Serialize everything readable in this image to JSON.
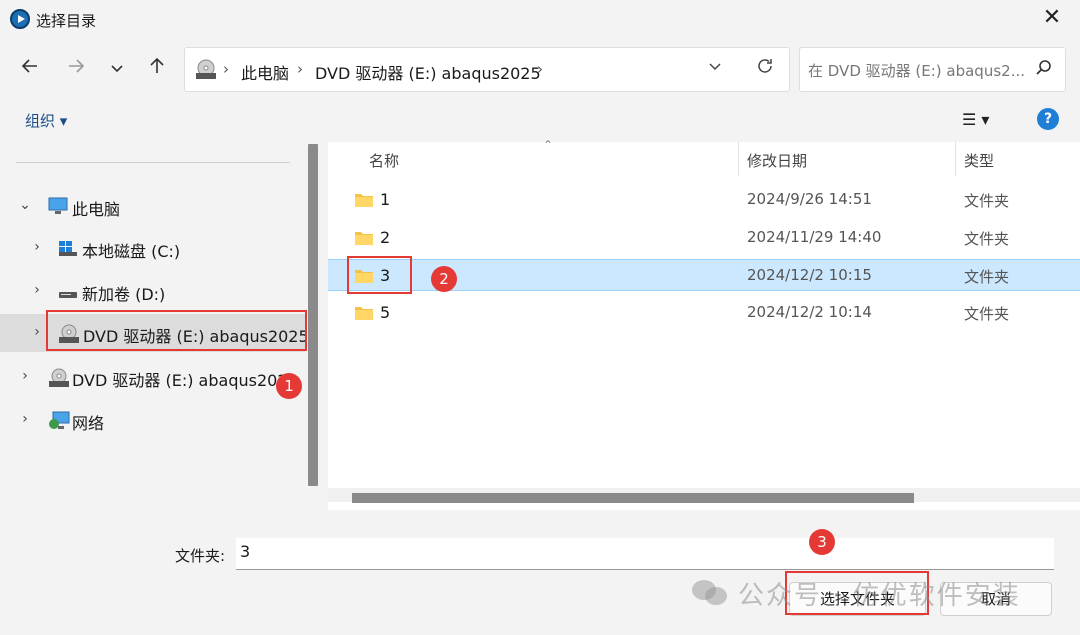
{
  "window": {
    "title": "选择目录",
    "close_glyph": "✕"
  },
  "nav": {
    "back_icon": "arrow-left-icon",
    "forward_icon": "arrow-right-icon",
    "recent_icon": "chevron-down-icon",
    "up_icon": "arrow-up-icon",
    "breadcrumb": [
      "此电脑",
      "DVD 驱动器 (E:) abaqus2025"
    ],
    "search_placeholder": "在 DVD 驱动器 (E:) abaqus2..."
  },
  "toolbar": {
    "organize_label": "组织 ▾",
    "view_label": "☰ ▾",
    "help_label": "?"
  },
  "sidebar": {
    "items": [
      {
        "label": "此电脑",
        "icon": "monitor-icon",
        "chevron": "⌄"
      },
      {
        "label": "本地磁盘 (C:)",
        "icon": "windows-drive-icon",
        "chevron": "›"
      },
      {
        "label": "新加卷 (D:)",
        "icon": "drive-icon",
        "chevron": "›"
      },
      {
        "label": "DVD 驱动器 (E:) abaqus2025",
        "icon": "dvd-icon",
        "chevron": "›"
      },
      {
        "label": "DVD 驱动器 (E:) abaqus2025",
        "icon": "dvd-icon",
        "chevron": "›"
      },
      {
        "label": "网络",
        "icon": "network-icon",
        "chevron": "›"
      }
    ]
  },
  "files": {
    "columns": [
      "名称",
      "修改日期",
      "类型"
    ],
    "rows": [
      {
        "name": "1",
        "date": "2024/9/26 14:51",
        "type": "文件夹"
      },
      {
        "name": "2",
        "date": "2024/11/29 14:40",
        "type": "文件夹"
      },
      {
        "name": "3",
        "date": "2024/12/2 10:15",
        "type": "文件夹"
      },
      {
        "name": "5",
        "date": "2024/12/2 10:14",
        "type": "文件夹"
      }
    ]
  },
  "footer": {
    "folder_label": "文件夹:",
    "folder_value": "3",
    "select_button": "选择文件夹",
    "cancel_button": "取消"
  },
  "annotations": {
    "m1": "1",
    "m2": "2",
    "m3": "3"
  },
  "watermark": "公众号 · 仿优软件安装",
  "colors": {
    "accent": "#1f7fd6",
    "selection": "#cce8ff",
    "highlight_box": "#e53935"
  }
}
